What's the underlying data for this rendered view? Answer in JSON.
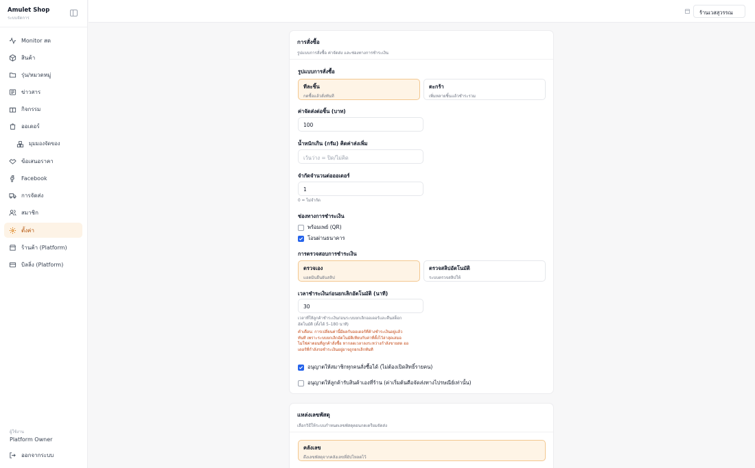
{
  "brand": {
    "title": "Amulet Shop",
    "subtitle": "ระบบจัดการ"
  },
  "nav": [
    {
      "label": "Monitor สด"
    },
    {
      "label": "สินค้า"
    },
    {
      "label": "รุ่น/หมวดหมู่"
    },
    {
      "label": "ข่าวสาร"
    },
    {
      "label": "กิจกรรม"
    },
    {
      "label": "ออเดอร์"
    },
    {
      "label": "มุมมองจัดของ"
    },
    {
      "label": "ข้อเสนอราคา"
    },
    {
      "label": "Facebook"
    },
    {
      "label": "การจัดส่ง"
    },
    {
      "label": "สมาชิก"
    },
    {
      "label": "ตั้งค่า"
    },
    {
      "label": "ร้านค้า (Platform)"
    },
    {
      "label": "บิลลิ่ง (Platform)"
    }
  ],
  "user": {
    "label": "ผู้ใช้งาน",
    "name": "Platform Owner",
    "logout": "ออกจากระบบ"
  },
  "topbar": {
    "store": "ร้านเวสสุวรรณ"
  },
  "order_card": {
    "title": "การสั่งซื้อ",
    "desc": "รูปแบบการสั่งซื้อ ค่าจัดส่ง และช่องทางการชำระเงิน",
    "mode_label": "รูปแบบการสั่งซื้อ",
    "modes": [
      {
        "title": "ทีละชิ้น",
        "desc": "กดซื้อแล้วสั่งทันที"
      },
      {
        "title": "ตะกร้า",
        "desc": "เพิ่มหลายชิ้นแล้วชำระรวม"
      }
    ],
    "shipping_label": "ค่าจัดส่งต่อชิ้น (บาท)",
    "shipping_value": "100",
    "weight_label": "น้ำหนักเกิน (กรัม) คิดค่าส่งเพิ่ม",
    "weight_placeholder": "เว้นว่าง = ปิด/ไม่คิด",
    "limit_label": "จำกัดจำนวนต่อออเดอร์",
    "limit_value": "1",
    "limit_help": "0 = ไม่จำกัด",
    "pay_label": "ช่องทางการชำระเงิน",
    "pay_options": [
      {
        "label": "พร้อมเพย์ (QR)",
        "checked": false
      },
      {
        "label": "โอนผ่านธนาคาร",
        "checked": true
      }
    ],
    "verify_label": "การตรวจสอบการชำระเงิน",
    "verify_modes": [
      {
        "title": "ตรวจเอง",
        "desc": "แอดมินยืนยันสลิป"
      },
      {
        "title": "ตรวจสลิปอัตโนมัติ",
        "desc": "ระบบตรวจสลิปให้"
      }
    ],
    "timeout_label": "เวลาชำระเงินก่อนยกเลิกอัตโนมัติ (นาที)",
    "timeout_value": "30",
    "timeout_help": [
      "เวลาที่ให้ลูกค้าชำระเงินก่อนระบบยกเลิกออเดอร์และคืนสต็อก",
      "อัตโนมัติ (ตั้งได้ 5–180 นาที)"
    ],
    "warning": [
      "คำเตือน: การเปลี่ยนค่านี้มีผลกับออเดอร์ที่ค้างชำระเงินอยู่แล้ว",
      "ทันที เพราะระบบยกเลิกอัตโนมัติเทียบกับค่าที่ตั้งไว้ล่าสุดเสมอ",
      "ไม่ใช่ค่าตอนที่ลูกค้าสั่งซื้อ หากลดเวลาลงระหว่างกำลังขายสด ออ",
      "เดอร์ที่กำลังรอชำระเงินอยู่อาจถูกยกเลิกทันที"
    ],
    "allow_all": {
      "label": "อนุญาตให้สมาชิกทุกคนสั่งซื้อได้ (ไม่ต้องเปิดสิทธิ์รายคน)",
      "checked": true
    },
    "allow_pickup": {
      "label": "อนุญาตให้ลูกค้ารับสินค้าเองที่ร้าน (ค่าเริ่มต้นคือจัดส่งทางไปรษณีย์เท่านั้น)",
      "checked": false
    }
  },
  "tracking_card": {
    "title": "แหล่งเลขพัสดุ",
    "desc": "เลือกวิธีให้ระบบกำหนดเลขพัสดุตอนกดเตรียมจัดส่ง",
    "option": {
      "title": "คลังเลข",
      "desc": "ดึงเลขพัสดุจากคลังเลขที่อัปโหลดไว้"
    }
  }
}
